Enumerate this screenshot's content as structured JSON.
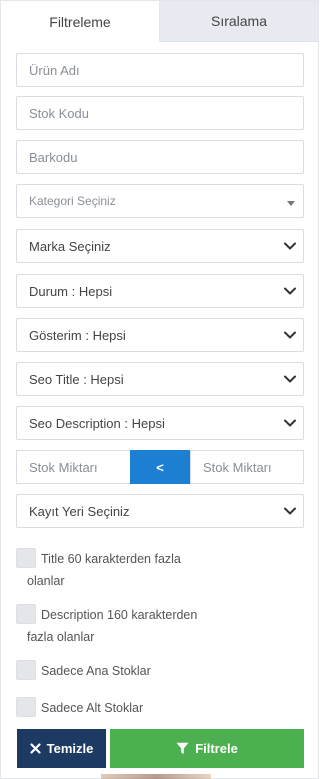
{
  "tabs": [
    {
      "label": "Filtreleme"
    },
    {
      "label": "Sıralama"
    }
  ],
  "fields": {
    "product_name_placeholder": "Ürün Adı",
    "stock_code_placeholder": "Stok Kodu",
    "barcode_placeholder": "Barkodu",
    "category_placeholder": "Kategori Seçiniz",
    "brand_select": "Marka Seçiniz",
    "status_select": "Durum : Hepsi",
    "display_select": "Gösterim : Hepsi",
    "seo_title_select": "Seo Title : Hepsi",
    "seo_description_select": "Seo Description : Hepsi",
    "stock_min_placeholder": "Stok Miktarı",
    "stock_operator": "<",
    "stock_max_placeholder": "Stok Miktarı",
    "record_place_select": "Kayıt Yeri Seçiniz"
  },
  "checkboxes": [
    {
      "line1": "Title 60 karakterden fazla",
      "line2": "olanlar"
    },
    {
      "line1": "Description 160 karakterden",
      "line2": "fazla olanlar"
    },
    {
      "line1": "Sadece Ana Stoklar"
    },
    {
      "line1": "Sadece Alt Stoklar"
    }
  ],
  "buttons": {
    "clear_label": "Temizle",
    "filter_label": "Filtrele"
  },
  "colors": {
    "primary_blue": "#1d7fd1",
    "navy": "#1d3a63",
    "green": "#4caf50",
    "tab_inactive_bg": "#e7eaf0"
  }
}
